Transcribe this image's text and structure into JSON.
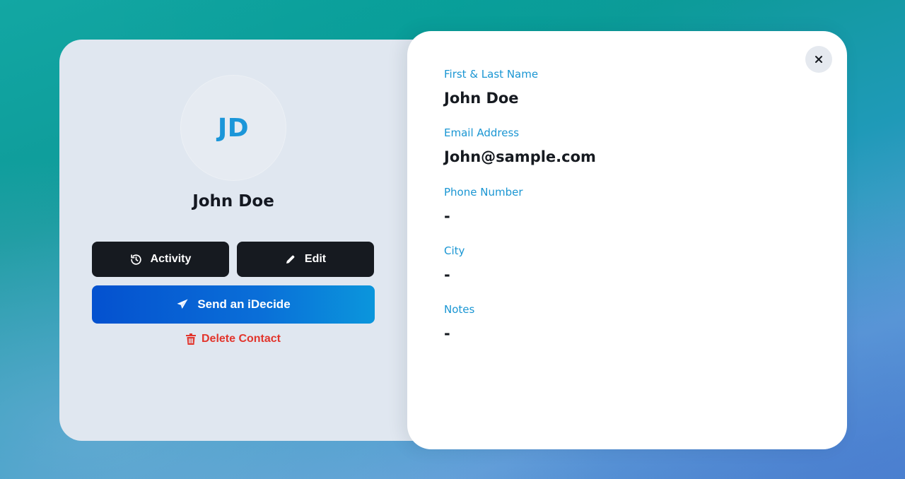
{
  "profile": {
    "initials": "JD",
    "name": "John Doe"
  },
  "actions": {
    "activity_label": "Activity",
    "edit_label": "Edit",
    "send_label": "Send an iDecide",
    "delete_label": "Delete Contact"
  },
  "details": {
    "fields": [
      {
        "label": "First & Last Name",
        "value": "John Doe"
      },
      {
        "label": "Email Address",
        "value": "John@sample.com"
      },
      {
        "label": "Phone Number",
        "value": "-"
      },
      {
        "label": "City",
        "value": "-"
      },
      {
        "label": "Notes",
        "value": "-"
      }
    ]
  },
  "icons": {
    "activity": "history-icon",
    "edit": "pencil-icon",
    "send": "paper-plane-icon",
    "delete": "trash-icon",
    "close": "close-icon"
  },
  "colors": {
    "accent_blue": "#1a96d3",
    "button_dark": "#161a20",
    "send_gradient_start": "#0451cf",
    "send_gradient_end": "#0b96dc",
    "danger": "#e2352c"
  }
}
